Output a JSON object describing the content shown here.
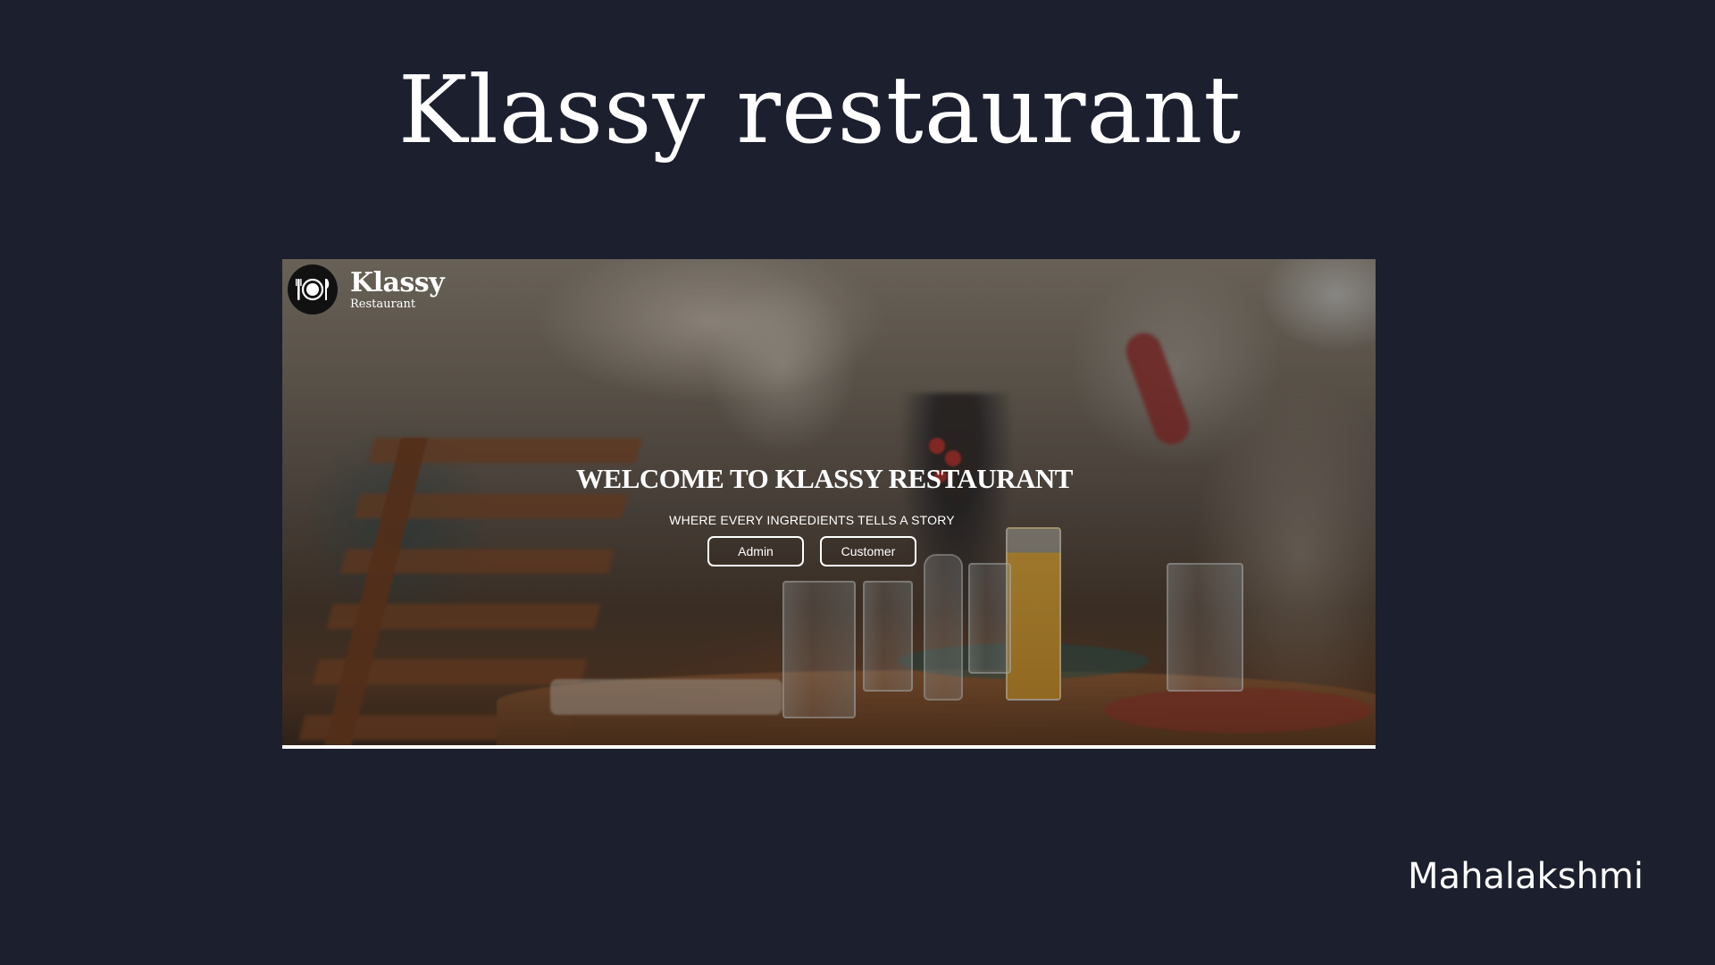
{
  "slide": {
    "title": "Klassy restaurant",
    "author": "Mahalakshmi",
    "background_color": "#1b1f2e"
  },
  "screenshot": {
    "brand": {
      "logo_icon": "plate-fork-knife-icon",
      "name": "Klassy",
      "subtitle": "Restaurant"
    },
    "hero": {
      "title": "WELCOME TO KLASSY RESTAURANT",
      "subtitle": "WHERE EVERY INGREDIENTS TELLS A STORY",
      "buttons": [
        {
          "label": "Admin"
        },
        {
          "label": "Customer"
        }
      ]
    }
  }
}
